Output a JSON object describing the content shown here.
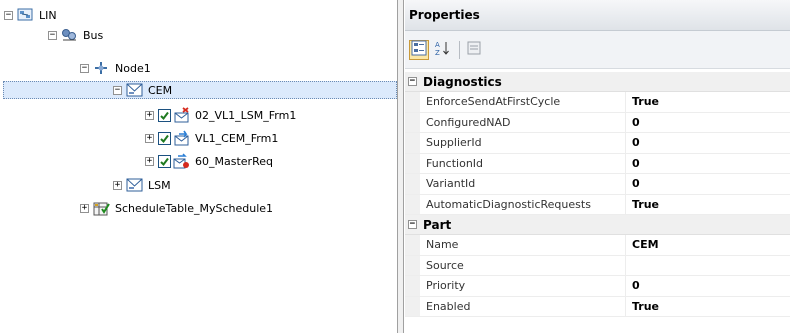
{
  "tree": {
    "nodes": [
      {
        "label": "LIN",
        "expander": "−",
        "icon": "lin-network-icon"
      },
      {
        "label": "Bus",
        "expander": "−",
        "icon": "bus-icon"
      },
      {
        "label": "Node1",
        "expander": "−",
        "icon": "node-icon"
      },
      {
        "label": "CEM",
        "expander": "−",
        "icon": "ecu-icon",
        "selected": true
      },
      {
        "label": "02_VL1_LSM_Frm1",
        "expander": "+",
        "icon": "frame-receive-icon",
        "checked": true
      },
      {
        "label": "VL1_CEM_Frm1",
        "expander": "+",
        "icon": "frame-transmit-icon",
        "checked": true
      },
      {
        "label": "60_MasterReq",
        "expander": "+",
        "icon": "master-request-icon",
        "checked": true
      },
      {
        "label": "LSM",
        "expander": "+",
        "icon": "ecu-icon"
      },
      {
        "label": "ScheduleTable_MySchedule1",
        "expander": "+",
        "icon": "schedule-table-icon"
      }
    ]
  },
  "properties": {
    "title": "Properties",
    "toolbar": {
      "categorized": "categorized-view-icon",
      "alphabetical": "alphabetical-sort-icon",
      "property_pages": "property-pages-icon"
    },
    "categories": [
      {
        "name": "Diagnostics",
        "expander": "−",
        "rows": [
          {
            "name": "EnforceSendAtFirstCycle",
            "value": "True"
          },
          {
            "name": "ConfiguredNAD",
            "value": "0"
          },
          {
            "name": "SupplierId",
            "value": "0"
          },
          {
            "name": "FunctionId",
            "value": "0"
          },
          {
            "name": "VariantId",
            "value": "0"
          },
          {
            "name": "AutomaticDiagnosticRequests",
            "value": "True"
          }
        ]
      },
      {
        "name": "Part",
        "expander": "−",
        "rows": [
          {
            "name": "Name",
            "value": "CEM"
          },
          {
            "name": "Source",
            "value": ""
          },
          {
            "name": "Priority",
            "value": "0"
          },
          {
            "name": "Enabled",
            "value": "True"
          }
        ]
      }
    ]
  }
}
